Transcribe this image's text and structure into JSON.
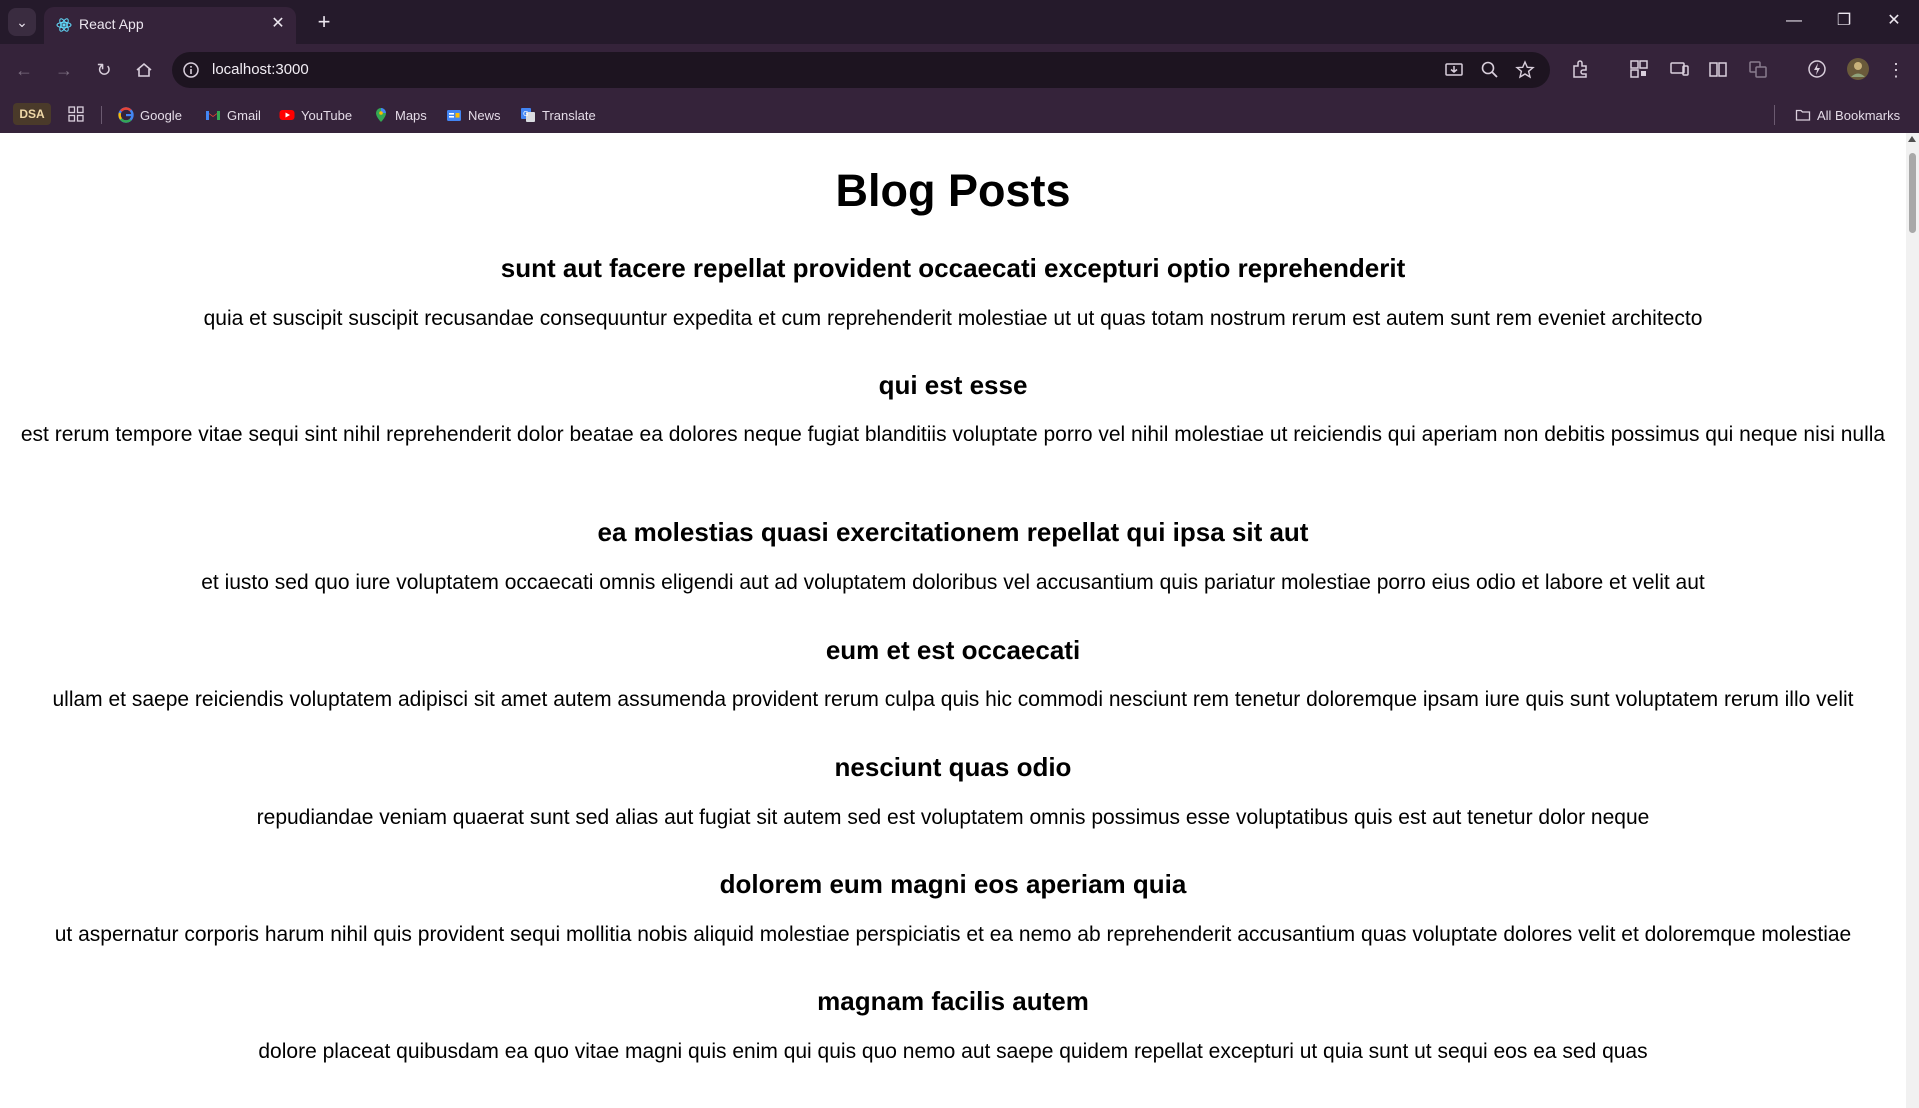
{
  "browser": {
    "tab": {
      "title": "React App"
    },
    "omnibox": {
      "url": "localhost:3000"
    },
    "bookmarks": {
      "dsa_label": "DSA",
      "items": [
        {
          "label": "Google",
          "icon": "google-icon"
        },
        {
          "label": "Gmail",
          "icon": "gmail-icon"
        },
        {
          "label": "YouTube",
          "icon": "youtube-icon"
        },
        {
          "label": "Maps",
          "icon": "maps-icon"
        },
        {
          "label": "News",
          "icon": "news-icon"
        },
        {
          "label": "Translate",
          "icon": "translate-icon"
        }
      ],
      "all_bookmarks": "All Bookmarks"
    }
  },
  "page": {
    "title": "Blog Posts",
    "posts": [
      {
        "title": "sunt aut facere repellat provident occaecati excepturi optio reprehenderit",
        "body": "quia et suscipit suscipit recusandae consequuntur expedita et cum reprehenderit molestiae ut ut quas totam nostrum rerum est autem sunt rem eveniet architecto"
      },
      {
        "title": "qui est esse",
        "body": "est rerum tempore vitae sequi sint nihil reprehenderit dolor beatae ea dolores neque fugiat blanditiis voluptate porro vel nihil molestiae ut reiciendis qui aperiam non debitis possimus qui neque nisi nulla"
      },
      {
        "title": "ea molestias quasi exercitationem repellat qui ipsa sit aut",
        "body": "et iusto sed quo iure voluptatem occaecati omnis eligendi aut ad voluptatem doloribus vel accusantium quis pariatur molestiae porro eius odio et labore et velit aut"
      },
      {
        "title": "eum et est occaecati",
        "body": "ullam et saepe reiciendis voluptatem adipisci sit amet autem assumenda provident rerum culpa quis hic commodi nesciunt rem tenetur doloremque ipsam iure quis sunt voluptatem rerum illo velit"
      },
      {
        "title": "nesciunt quas odio",
        "body": "repudiandae veniam quaerat sunt sed alias aut fugiat sit autem sed est voluptatem omnis possimus esse voluptatibus quis est aut tenetur dolor neque"
      },
      {
        "title": "dolorem eum magni eos aperiam quia",
        "body": "ut aspernatur corporis harum nihil quis provident sequi mollitia nobis aliquid molestiae perspiciatis et ea nemo ab reprehenderit accusantium quas voluptate dolores velit et doloremque molestiae"
      },
      {
        "title": "magnam facilis autem",
        "body": "dolore placeat quibusdam ea quo vitae magni quis enim qui quis quo nemo aut saepe quidem repellat excepturi ut quia sunt ut sequi eos ea sed quas"
      }
    ]
  }
}
